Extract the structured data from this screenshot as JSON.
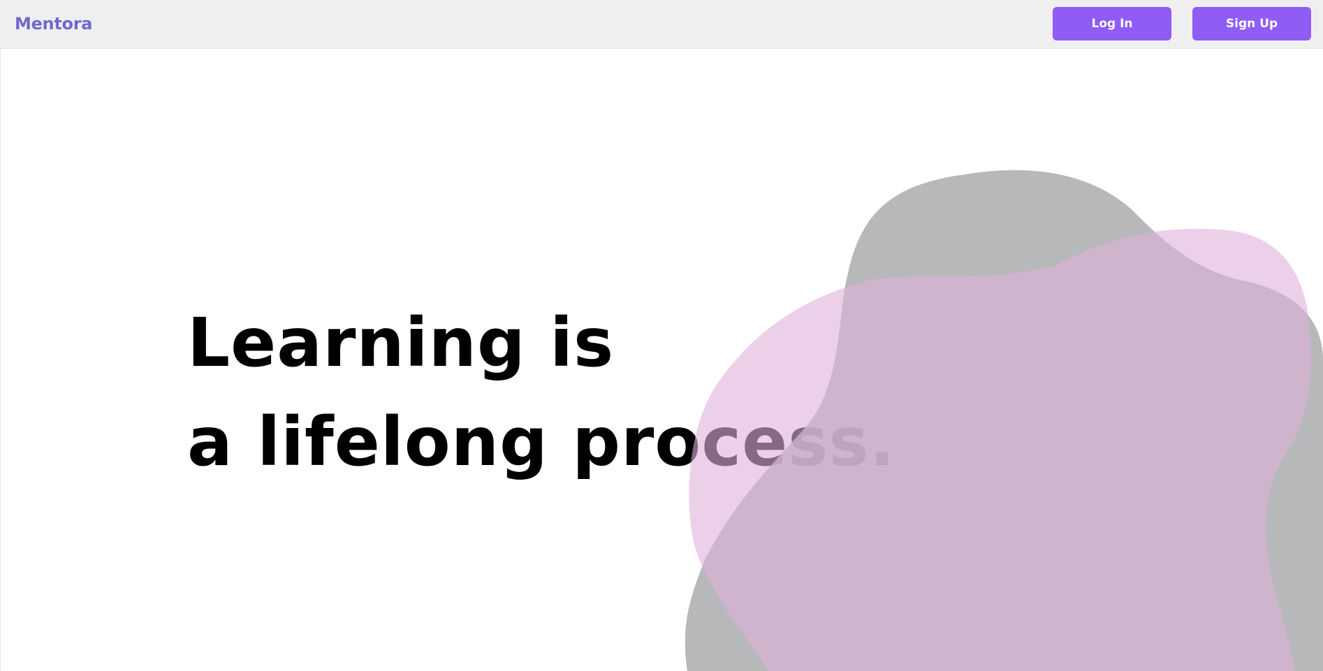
{
  "header": {
    "brand": "Mentora",
    "login_label": "Log In",
    "signup_label": "Sign Up"
  },
  "hero": {
    "line1": "Learning is",
    "line2": "a lifelong process."
  },
  "colors": {
    "brand": "#7168cc",
    "button": "#8f5cf6",
    "header_bg": "#efefef",
    "blob_gray": "#a9abad",
    "blob_pink": "#dfb1da"
  }
}
